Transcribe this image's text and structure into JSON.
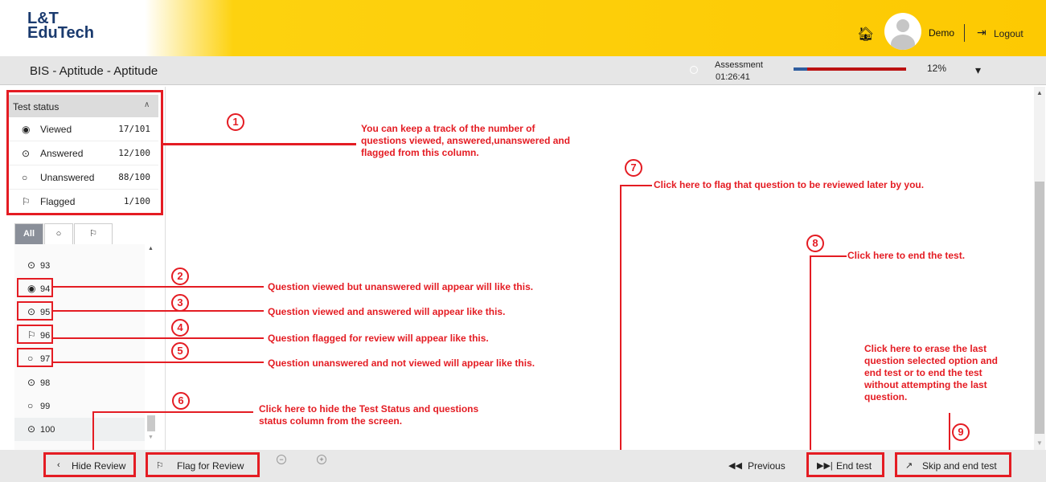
{
  "header": {
    "logo_line1": "L&T",
    "logo_line2": "EduTech",
    "home_icon": "home-icon",
    "user_name": "Demo",
    "logout_label": "Logout",
    "brand_color": "#fdc902"
  },
  "subheader": {
    "title": "BIS - Aptitude - Aptitude",
    "assessment_label": "Assessment",
    "timer": "01:26:41",
    "progress_percent": 12,
    "progress_label": "12%"
  },
  "test_status": {
    "title": "Test status",
    "rows": [
      {
        "icon": "eye-icon",
        "label": "Viewed",
        "count": "17/101"
      },
      {
        "icon": "radio-checked-icon",
        "label": "Answered",
        "count": "12/100"
      },
      {
        "icon": "radio-empty-icon",
        "label": "Unanswered",
        "count": "88/100"
      },
      {
        "icon": "flag-icon",
        "label": "Flagged",
        "count": "1/100"
      }
    ]
  },
  "filter_tabs": {
    "all": "All"
  },
  "questions": [
    {
      "number": "93",
      "state": "answered"
    },
    {
      "number": "94",
      "state": "viewed"
    },
    {
      "number": "95",
      "state": "answered"
    },
    {
      "number": "96",
      "state": "flagged"
    },
    {
      "number": "97",
      "state": "unanswered"
    },
    {
      "number": "98",
      "state": "answered"
    },
    {
      "number": "99",
      "state": "unanswered"
    },
    {
      "number": "100",
      "state": "answered"
    }
  ],
  "annotations": {
    "n1": "1",
    "n2": "2",
    "n3": "3",
    "n4": "4",
    "n5": "5",
    "n6": "6",
    "n7": "7",
    "n8": "8",
    "n9": "9",
    "a1_l1": "You can keep a track of the number of",
    "a1_l2": "questions viewed, answered,unanswered and",
    "a1_l3": "flagged from this column.",
    "a2": "Question viewed but unanswered will appear will like this.",
    "a3": "Question viewed and answered will appear like this.",
    "a4": "Question flagged for review will appear like this.",
    "a5": "Question unanswered and not viewed will appear like this.",
    "a6_l1": "Click here to hide the Test Status and questions",
    "a6_l2": "status column from the screen.",
    "a7": "Click here to flag that question to be reviewed later by you.",
    "a8": "Click here to end the test.",
    "a9_l1": "Click here to erase the last",
    "a9_l2": "question selected option and",
    "a9_l3": "end test or to end the test",
    "a9_l4": "without attempting the last",
    "a9_l5": "question.",
    "annotation_color": "#e41c23"
  },
  "footer": {
    "hide_review": "Hide Review",
    "flag_for_review": "Flag for Review",
    "previous": "Previous",
    "end_test": "End test",
    "skip_and_end": "Skip and end test"
  }
}
